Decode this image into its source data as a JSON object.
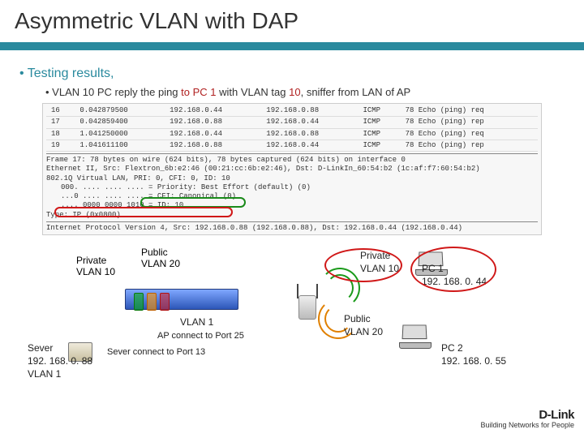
{
  "title": "Asymmetric VLAN with DAP",
  "bullets": {
    "main": "Testing results,",
    "sub_pre": "VLAN 10 PC reply the ping ",
    "sub_to": "to PC 1",
    "sub_mid": " with VLAN tag ",
    "sub_tag": "10",
    "sub_post": ", sniffer from LAN of AP"
  },
  "sniffer": {
    "rows": [
      {
        "no": "16",
        "ts": "0.042879500",
        "src": "192.168.0.44",
        "dst": "192.168.0.88",
        "proto": "ICMP",
        "info": "78 Echo (ping) req"
      },
      {
        "no": "17",
        "ts": "0.042859400",
        "src": "192.168.0.88",
        "dst": "192.168.0.44",
        "proto": "ICMP",
        "info": "78 Echo (ping) rep"
      },
      {
        "no": "18",
        "ts": "1.041250000",
        "src": "192.168.0.44",
        "dst": "192.168.0.88",
        "proto": "ICMP",
        "info": "78 Echo (ping) req"
      },
      {
        "no": "19",
        "ts": "1.041611100",
        "src": "192.168.0.88",
        "dst": "192.168.0.44",
        "proto": "ICMP",
        "info": "78 Echo (ping) rep"
      }
    ],
    "frame": "Frame 17: 78 bytes on wire (624 bits), 78 bytes captured (624 bits) on interface 0",
    "eth": "Ethernet II, Src: Flextron_6b:e2:46 (00:21:cc:6b:e2:46), Dst: D-LinkIn_60:54:b2 (1c:af:f7:60:54:b2)",
    "vlan": "802.1Q Virtual LAN, PRI: 0, CFI: 0, ID: 10",
    "pri": "000. .... .... .... = Priority: Best Effort (default) (0)",
    "cfi": "...0 .... .... .... = CFI: Canonical (0)",
    "id": ".... 0000 0000 1010 = ID: 10",
    "type": "Type: IP (0x0800)",
    "ip": "Internet Protocol Version 4, Src: 192.168.0.88 (192.168.0.88), Dst: 192.168.0.44 (192.168.0.44)"
  },
  "diagram": {
    "private_vlan10": "Private\nVLAN 10",
    "public_vlan20": "Public\nVLAN 20",
    "vlan1": "VLAN 1",
    "ap_port": "AP connect to Port 25",
    "server_label": "Sever",
    "server_ip": "192. 168. 0. 88",
    "server_vlan": "VLAN 1",
    "server_port": "Sever connect to Port 13",
    "right_private": "Private",
    "right_private_vlan": "VLAN 10",
    "right_public": "Public",
    "right_public_vlan": "VLAN 20",
    "pc1": "PC 1",
    "pc1_ip": "192. 168. 0. 44",
    "pc2": "PC 2",
    "pc2_ip": "192. 168. 0. 55"
  },
  "brand": {
    "name": "D-Link",
    "tagline": "Building Networks for People"
  }
}
